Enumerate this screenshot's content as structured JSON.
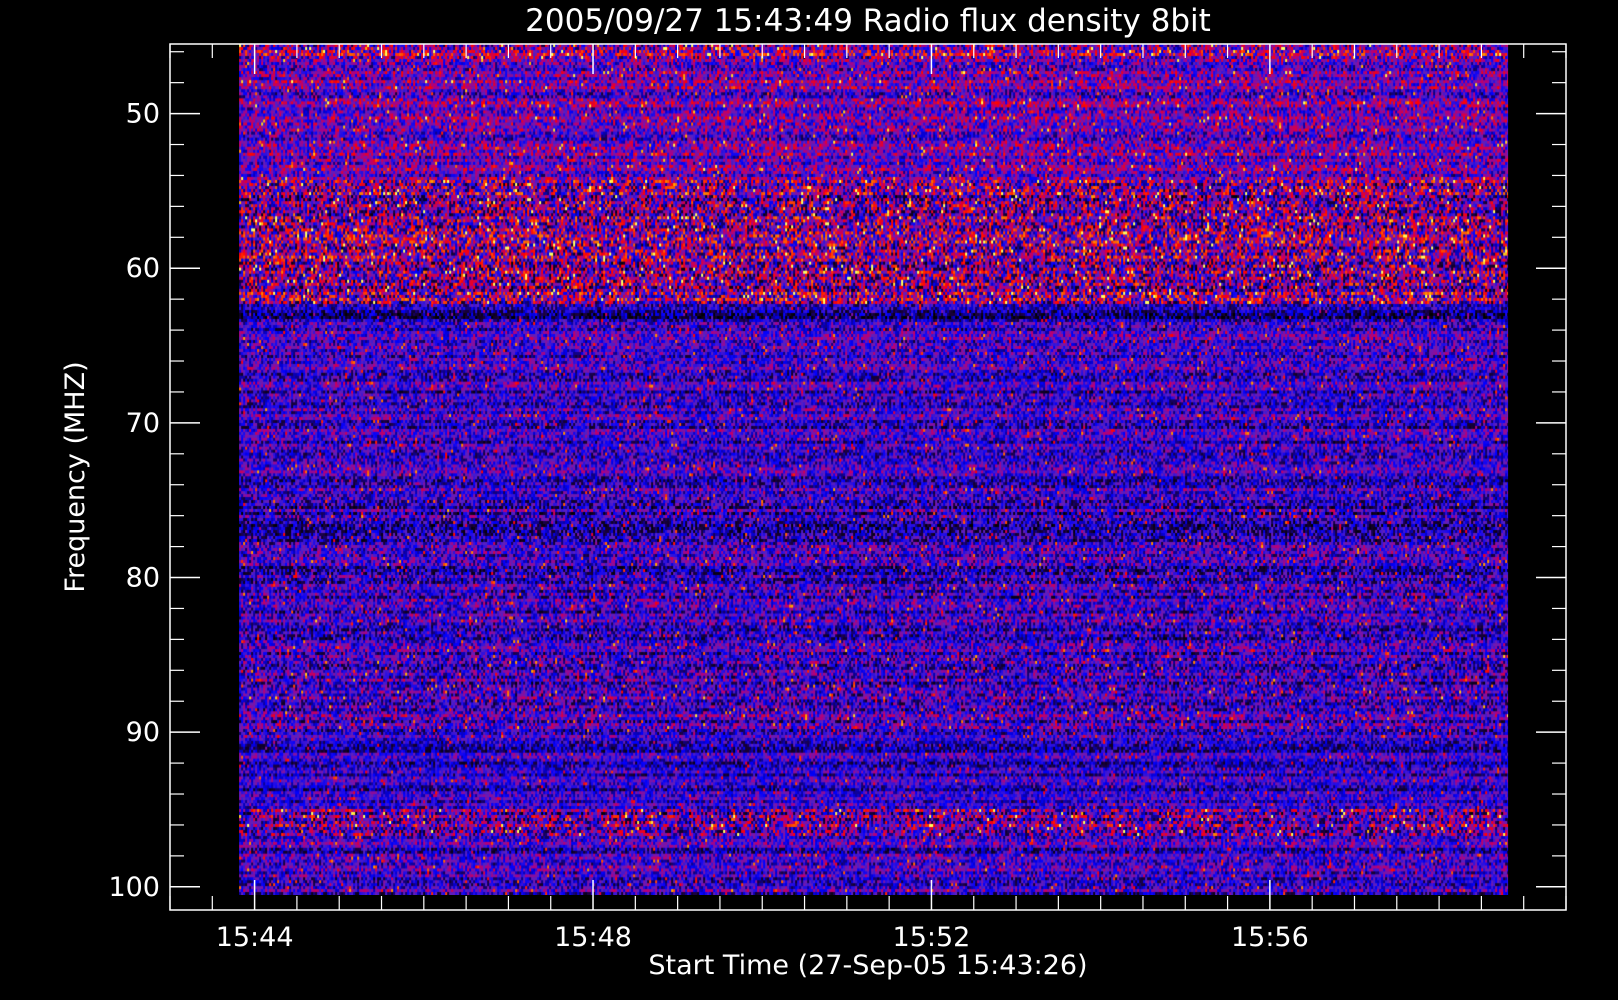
{
  "colors": {
    "background": "#000000",
    "axes": "#ffffff",
    "text": "#ffffff",
    "colormap": [
      "#000000",
      "#1a0040",
      "#0000ff",
      "#5a20c0",
      "#b00080",
      "#ff0000",
      "#ff6000",
      "#ffb000",
      "#ffff60"
    ]
  },
  "chart_data": {
    "type": "heatmap",
    "title": "2005/09/27 15:43:49 Radio flux density 8bit",
    "xlabel": "Start Time (27-Sep-05 15:43:26)",
    "ylabel": "Frequency (MHZ)",
    "y_reversed": true,
    "xlim": [
      "15:43:00",
      "15:59:30"
    ],
    "ylim": [
      45.5,
      101.5
    ],
    "x_ticks": [
      "15:44",
      "15:48",
      "15:52",
      "15:56"
    ],
    "y_ticks": [
      50,
      60,
      70,
      80,
      90,
      100
    ],
    "data_time_range": [
      "15:43:49",
      "15:58:49"
    ],
    "data_freq_range": [
      45.5,
      100.5
    ],
    "bands": [
      {
        "from": 45.5,
        "to": 46.5,
        "level": 0.45,
        "variability": 0.55
      },
      {
        "from": 46.5,
        "to": 54.3,
        "level": 0.38,
        "variability": 0.4
      },
      {
        "from": 54.3,
        "to": 62.3,
        "level": 0.42,
        "variability": 0.65
      },
      {
        "from": 62.3,
        "to": 63.5,
        "level": 0.2,
        "variability": 0.3
      },
      {
        "from": 63.5,
        "to": 66,
        "level": 0.32,
        "variability": 0.35
      },
      {
        "from": 66,
        "to": 70,
        "level": 0.3,
        "variability": 0.35
      },
      {
        "from": 70,
        "to": 75,
        "level": 0.3,
        "variability": 0.35
      },
      {
        "from": 75,
        "to": 80,
        "level": 0.28,
        "variability": 0.38
      },
      {
        "from": 80,
        "to": 85,
        "level": 0.3,
        "variability": 0.38
      },
      {
        "from": 85,
        "to": 90,
        "level": 0.32,
        "variability": 0.4
      },
      {
        "from": 90,
        "to": 95,
        "level": 0.27,
        "variability": 0.3
      },
      {
        "from": 95,
        "to": 96.7,
        "level": 0.38,
        "variability": 0.55
      },
      {
        "from": 96.7,
        "to": 100.5,
        "level": 0.3,
        "variability": 0.35
      }
    ]
  }
}
